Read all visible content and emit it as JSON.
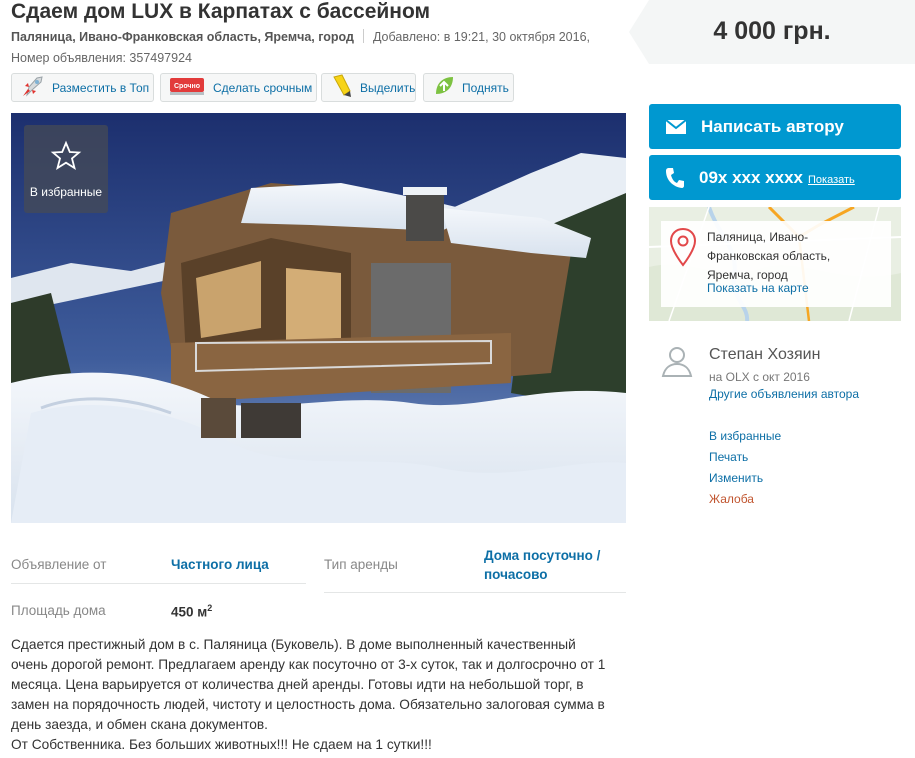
{
  "ad": {
    "title": "Сдаем дом LUX в Карпатах с бассейном",
    "location": "Паляница, Ивано-Франковская область, Яремча, город",
    "added": "Добавлено: в 19:21, 30 октября 2016,",
    "number": "Номер объявления: 357497924"
  },
  "promo": {
    "top_label": "Разместить в Топ",
    "urgent_label": "Сделать срочным",
    "urgent_badge": "Срочно",
    "highlight_label": "Выделить",
    "raise_label": "Поднять"
  },
  "price": "4 000 грн.",
  "contact": {
    "write_label": "Написать автору",
    "phone": "09х ххх хххх",
    "show_label": "Показать"
  },
  "map": {
    "address": "Паляница, Ивано-Франковская область, Яремча, город",
    "show_link": "Показать на карте"
  },
  "user": {
    "name": "Степан Хозяин",
    "since": "на OLX с окт 2016",
    "other_ads": "Другие объявления автора"
  },
  "actions": {
    "favorite": "В избранные",
    "print": "Печать",
    "edit": "Изменить",
    "complain": "Жалоба"
  },
  "photo": {
    "favorite_label": "В избранные"
  },
  "details": {
    "offer_from_label": "Объявление от",
    "offer_from_value": "Частного лица",
    "rent_type_label": "Тип аренды",
    "rent_type_value_1": "Дома посуточно /",
    "rent_type_value_2": "почасово",
    "area_label": "Площадь дома",
    "area_value": "450 м",
    "area_sup": "2"
  },
  "description": {
    "line1": "Сдается престижный дом в с. Паляница (Буковель). В доме выполненный качественный",
    "line2": "очень дорогой ремонт. Предлагаем аренду как посуточно от 3-х суток, так и долгосрочно от 1",
    "line3": "месяца. Цена варьируется от количества дней аренды. Готовы идти на небольшой торг, в",
    "line4": "замен на порядочность людей, чистоту и целостность дома. Обязательно залоговая сумма в",
    "line5": "день заезда, и обмен скана документов.",
    "line6": "От Собственника. Без больших животных!!! Не сдаем на 1 сутки!!!"
  },
  "colors": {
    "accent": "#0098d0",
    "link": "#0d6fa6",
    "complain": "#c1552f"
  }
}
